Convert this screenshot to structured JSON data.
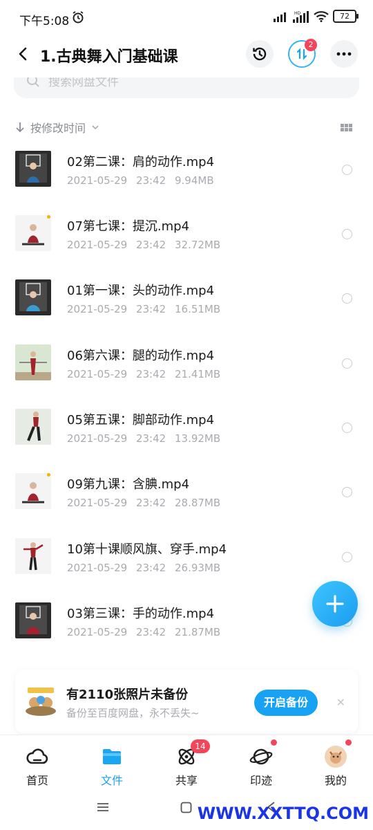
{
  "status_bar": {
    "time": "下午5:08",
    "battery": "72"
  },
  "header": {
    "title": "1.古典舞入门基础课",
    "transfer_badge": "2"
  },
  "search": {
    "placeholder": "搜索网盘文件"
  },
  "sort": {
    "label": "按修改时间"
  },
  "files": [
    {
      "name": "02第二课：肩的动作.mp4",
      "date": "2021-05-29",
      "time": "23:42",
      "size": "9.94MB",
      "thumb_bg": "#2b2b2b"
    },
    {
      "name": "07第七课：提沉.mp4",
      "date": "2021-05-29",
      "time": "23:42",
      "size": "32.72MB",
      "thumb_bg": "#f4f4f4"
    },
    {
      "name": "01第一课：头的动作.mp4",
      "date": "2021-05-29",
      "time": "23:42",
      "size": "16.51MB",
      "thumb_bg": "#2b2b2b"
    },
    {
      "name": "06第六课：腿的动作.mp4",
      "date": "2021-05-29",
      "time": "23:42",
      "size": "21.41MB",
      "thumb_bg": "#d9e6d2"
    },
    {
      "name": "05第五课：脚部动作.mp4",
      "date": "2021-05-29",
      "time": "23:42",
      "size": "13.92MB",
      "thumb_bg": "#e6ebe3"
    },
    {
      "name": "09第九课：含腆.mp4",
      "date": "2021-05-29",
      "time": "23:42",
      "size": "28.87MB",
      "thumb_bg": "#f4f4f4"
    },
    {
      "name": "10第十课顺风旗、穿手.mp4",
      "date": "2021-05-29",
      "time": "23:42",
      "size": "26.93MB",
      "thumb_bg": "#f4f4f4"
    },
    {
      "name": "03第三课：手的动作.mp4",
      "date": "2021-05-29",
      "time": "23:42",
      "size": "21.87MB",
      "thumb_bg": "#2b2b2b"
    }
  ],
  "banner": {
    "title": "有2110张照片未备份",
    "subtitle": "备份至百度网盘，永不丢失~",
    "button": "开启备份",
    "close": "✕"
  },
  "nav": [
    {
      "label": "首页",
      "icon": "cloud-icon"
    },
    {
      "label": "文件",
      "icon": "folder-icon",
      "active": true
    },
    {
      "label": "共享",
      "icon": "atom-icon",
      "badge": "14"
    },
    {
      "label": "印迹",
      "icon": "planet-icon"
    },
    {
      "label": "我的",
      "icon": "avatar-icon"
    }
  ],
  "watermark": "WWW.XXTTQ.COM",
  "colors": {
    "accent": "#18a2f4",
    "badge": "#f4465a",
    "watermark": "#1a35e6"
  }
}
